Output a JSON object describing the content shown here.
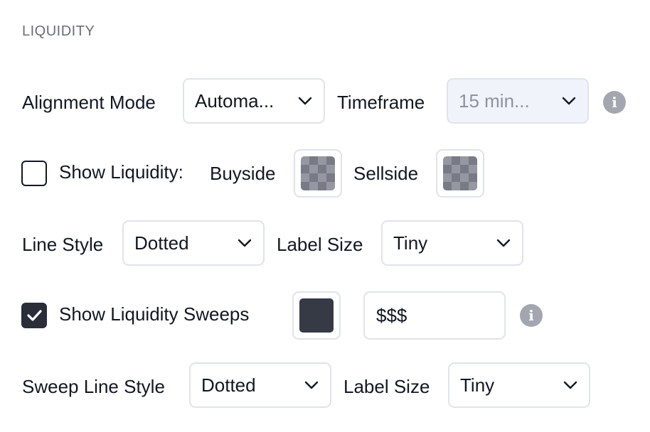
{
  "section": {
    "title": "LIQUIDITY"
  },
  "alignment": {
    "mode_label": "Alignment Mode",
    "mode_value": "Automa...",
    "timeframe_label": "Timeframe",
    "timeframe_value": "15 min..."
  },
  "liquidity": {
    "show_label": "Show Liquidity:",
    "show_checked": false,
    "buyside_label": "Buyside",
    "sellside_label": "Sellside"
  },
  "line": {
    "style_label": "Line Style",
    "style_value": "Dotted",
    "label_size_label": "Label Size",
    "label_size_value": "Tiny"
  },
  "sweeps": {
    "show_label": "Show Liquidity Sweeps",
    "show_checked": true,
    "color": "#363a45",
    "text_value": "$$$"
  },
  "sweep_line": {
    "style_label": "Sweep Line Style",
    "style_value": "Dotted",
    "label_size_label": "Label Size",
    "label_size_value": "Tiny"
  },
  "icons": {
    "info": "info-icon",
    "chevron": "chevron-down-icon",
    "check": "checkmark-icon",
    "info_glyph": "i"
  }
}
